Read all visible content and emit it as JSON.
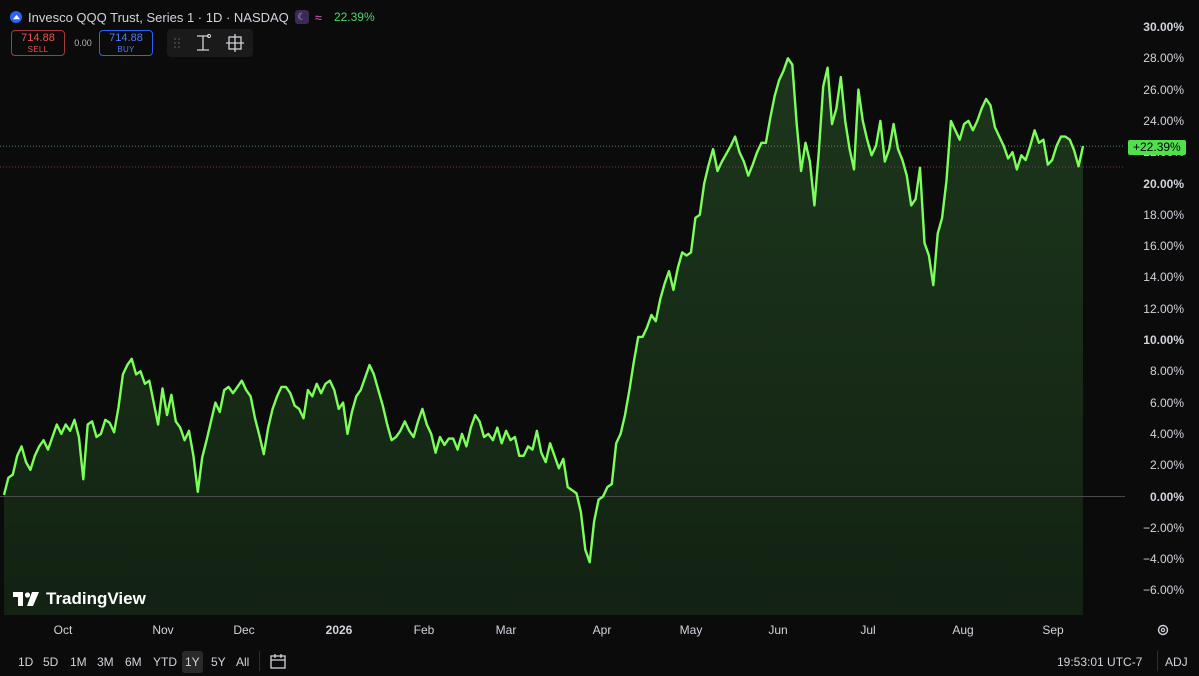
{
  "header": {
    "title": "Invesco QQQ Trust, Series 1 · 1D · NASDAQ",
    "change_pct": "22.39%"
  },
  "trade": {
    "sell_price": "714.88",
    "sell_label": "SELL",
    "spread": "0.00",
    "buy_price": "714.88",
    "buy_label": "BUY"
  },
  "last_value_label": "+22.39%",
  "brand": "TradingView",
  "bottom_bar": {
    "ranges": [
      "1D",
      "5D",
      "1M",
      "3M",
      "6M",
      "YTD",
      "1Y",
      "5Y",
      "All"
    ],
    "active_range": "1Y",
    "clock": "19:53:01 UTC-7",
    "adj": "ADJ"
  },
  "colors": {
    "line": "#7dff5a",
    "area": "#1e3a1e",
    "background": "#0b0b0b",
    "badge": "#4fe04c"
  },
  "icons": [
    "nasdaq-logo-icon",
    "moon-icon",
    "wave-icon",
    "grip-icon",
    "measure-icon",
    "crosshair-icon",
    "gear-icon",
    "calendar-icon",
    "tradingview-logo-icon"
  ],
  "chart_data": {
    "type": "area",
    "y_unit": "%",
    "ylim": [
      -7.5,
      30.5
    ],
    "y_ticks": [
      "30.00%",
      "28.00%",
      "26.00%",
      "24.00%",
      "22.00%",
      "20.00%",
      "18.00%",
      "16.00%",
      "14.00%",
      "12.00%",
      "10.00%",
      "8.00%",
      "6.00%",
      "4.00%",
      "2.00%",
      "0.00%",
      "−2.00%",
      "−4.00%",
      "−6.00%"
    ],
    "bold_y_ticks": [
      "30.00%",
      "20.00%",
      "10.00%",
      "0.00%"
    ],
    "x_ticks": [
      "Oct",
      "Nov",
      "Dec",
      "2026",
      "Feb",
      "Mar",
      "Apr",
      "May",
      "Jun",
      "Jul",
      "Aug",
      "Sep"
    ],
    "bold_x_ticks": [
      "2026"
    ],
    "baseline": 0,
    "last_value": 22.39,
    "grid": false,
    "series": [
      {
        "values": [
          0.1,
          1.2,
          1.4,
          2.6,
          3.2,
          2.2,
          1.7,
          2.6,
          3.2,
          3.6,
          3.0,
          3.8,
          4.6,
          4.0,
          4.6,
          4.2,
          4.9,
          3.8,
          1.1,
          4.6,
          4.8,
          3.8,
          4.0,
          4.9,
          4.7,
          4.1,
          5.7,
          7.8,
          8.4,
          8.8,
          7.8,
          8.0,
          7.2,
          7.4,
          6.0,
          4.6,
          6.9,
          5.2,
          6.5,
          4.8,
          4.4,
          3.6,
          4.2,
          2.6,
          0.3,
          2.5,
          3.6,
          4.8,
          6.0,
          5.4,
          6.8,
          7.0,
          6.6,
          7.0,
          7.4,
          6.8,
          6.4,
          5.0,
          3.9,
          2.7,
          4.4,
          5.6,
          6.4,
          7.0,
          7.0,
          6.6,
          5.8,
          5.6,
          5.0,
          6.8,
          6.4,
          7.2,
          6.6,
          7.2,
          7.4,
          6.8,
          5.6,
          6.0,
          4.0,
          5.4,
          6.4,
          6.8,
          7.6,
          8.4,
          7.8,
          6.8,
          5.8,
          4.6,
          3.6,
          3.8,
          4.2,
          4.8,
          4.2,
          3.8,
          4.8,
          5.6,
          4.6,
          4.0,
          2.8,
          3.8,
          3.3,
          3.7,
          3.7,
          3.0,
          4.0,
          3.2,
          4.4,
          5.2,
          4.8,
          3.8,
          4.0,
          3.6,
          4.4,
          3.4,
          4.2,
          3.6,
          3.8,
          2.6,
          2.6,
          3.2,
          3.0,
          4.2,
          2.8,
          2.2,
          3.4,
          2.6,
          1.8,
          2.4,
          0.6,
          0.4,
          0.2,
          -1.0,
          -3.4,
          -4.2,
          -1.6,
          -0.2,
          0.0,
          0.6,
          0.8,
          3.4,
          4.0,
          5.2,
          6.8,
          8.6,
          10.2,
          10.2,
          10.8,
          11.6,
          11.2,
          12.6,
          13.6,
          14.4,
          13.2,
          14.6,
          15.6,
          15.4,
          15.6,
          17.8,
          18.0,
          20.0,
          21.2,
          22.2,
          20.8,
          21.4,
          21.9,
          22.4,
          23.0,
          22.0,
          21.4,
          20.5,
          21.2,
          22.0,
          22.6,
          22.6,
          24.2,
          25.6,
          26.6,
          27.2,
          28.0,
          27.6,
          23.8,
          20.8,
          22.6,
          21.4,
          18.6,
          22.0,
          26.2,
          27.4,
          23.8,
          24.8,
          26.8,
          24.0,
          22.2,
          20.9,
          26.0,
          24.0,
          22.8,
          21.8,
          22.4,
          24.0,
          21.4,
          22.2,
          23.8,
          22.2,
          21.5,
          20.5,
          18.6,
          19.0,
          21.0,
          16.2,
          15.4,
          13.5,
          16.8,
          17.8,
          20.2,
          24.0,
          23.4,
          22.8,
          23.8,
          24.0,
          23.4,
          24.0,
          24.8,
          25.4,
          25.0,
          23.6,
          23.0,
          22.4,
          21.6,
          22.0,
          20.9,
          21.8,
          21.5,
          22.4,
          23.4,
          22.6,
          22.8,
          21.2,
          21.5,
          22.4,
          23.0,
          23.0,
          22.8,
          22.1,
          21.1,
          22.39
        ]
      }
    ]
  }
}
